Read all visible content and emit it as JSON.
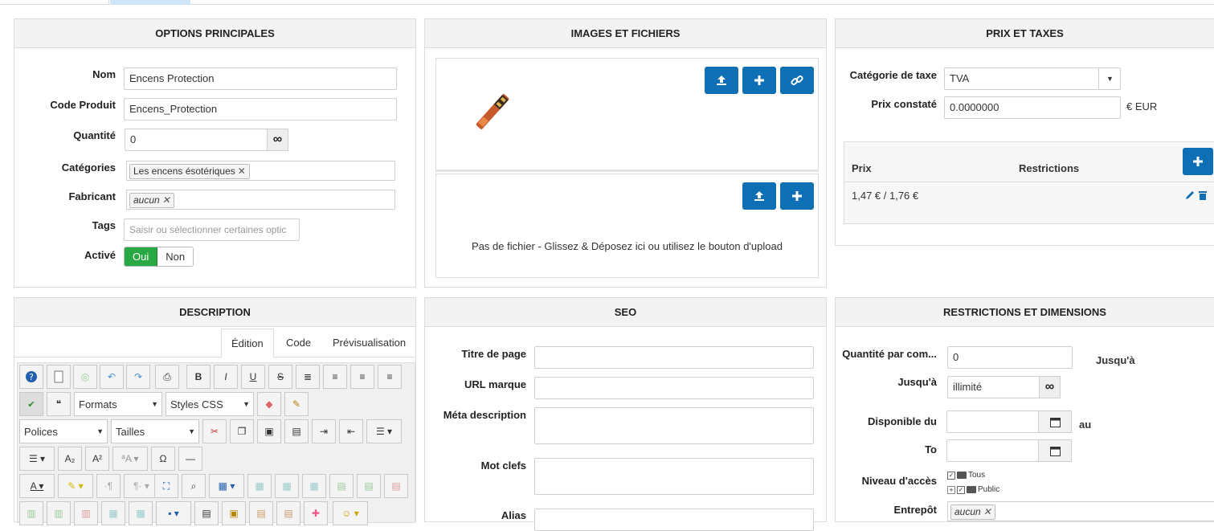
{
  "panels": {
    "main_options": {
      "title": "OPTIONS PRINCIPALES",
      "nom_label": "Nom",
      "nom_value": "Encens Protection",
      "code_label": "Code Produit",
      "code_value": "Encens_Protection",
      "qty_label": "Quantité",
      "qty_value": "0",
      "cat_label": "Catégories",
      "cat_tag": "Les encens ésotériques",
      "fab_label": "Fabricant",
      "fab_tag": "aucun",
      "tags_label": "Tags",
      "tags_placeholder": "Saisir ou sélectionner certaines optic",
      "active_label": "Activé",
      "active_yes": "Oui",
      "active_no": "Non"
    },
    "images": {
      "title": "IMAGES ET FICHIERS",
      "no_file_text": "Pas de fichier - Glissez & Déposez ici ou utilisez le bouton d'upload"
    },
    "prix": {
      "title": "PRIX ET TAXES",
      "tax_cat_label": "Catégorie de taxe",
      "tax_cat_value": "TVA",
      "prix_label": "Prix constaté",
      "prix_value": "0.0000000",
      "prix_unit": "€ EUR",
      "table_col_prix": "Prix",
      "table_col_restrictions": "Restrictions",
      "row_value": "1,47 € / 1,76 €"
    },
    "description": {
      "title": "DESCRIPTION",
      "tabs": [
        "Édition",
        "Code",
        "Prévisualisation"
      ],
      "formats": "Formats",
      "styles": "Styles CSS",
      "polices": "Polices",
      "tailles": "Tailles"
    },
    "seo": {
      "title": "SEO",
      "page_title_label": "Titre de page",
      "url_label": "URL marque",
      "meta_label": "Méta description",
      "keywords_label": "Mot clefs",
      "alias_label": "Alias"
    },
    "restrictions": {
      "title": "RESTRICTIONS ET DIMENSIONS",
      "qty_order_label": "Quantité par com...",
      "qty_order_value": "0",
      "until_inline": "Jusqu'à",
      "until_label": "Jusqu'à",
      "until_value": "illimité",
      "available_label": "Disponible du",
      "au": "au",
      "to_label": "To",
      "access_label": "Niveau d'accès",
      "access_tous": "Tous",
      "access_public": "Public",
      "warehouse_label": "Entrepôt",
      "warehouse_tag": "aucun"
    }
  },
  "colors": {
    "blue": "#0f6fb5",
    "green": "#28a745",
    "header_bg": "#f3f3f3"
  }
}
